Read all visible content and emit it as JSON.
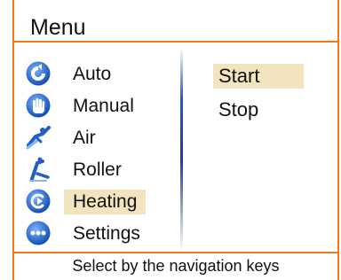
{
  "header": {
    "title": "Menu"
  },
  "menu": {
    "items": [
      {
        "label": "Auto",
        "icon": "auto-icon",
        "selected": false
      },
      {
        "label": "Manual",
        "icon": "hand-icon",
        "selected": false
      },
      {
        "label": "Air",
        "icon": "air-massage-icon",
        "selected": false
      },
      {
        "label": "Roller",
        "icon": "roller-icon",
        "selected": false
      },
      {
        "label": "Heating",
        "icon": "heating-icon",
        "selected": true
      },
      {
        "label": "Settings",
        "icon": "settings-icon",
        "selected": false
      }
    ]
  },
  "options": {
    "items": [
      {
        "label": "Start",
        "selected": true
      },
      {
        "label": "Stop",
        "selected": false
      }
    ]
  },
  "footer": {
    "hint": "Select by the navigation keys"
  },
  "colors": {
    "accent": "#f07b1f",
    "highlight": "#f3e4c0",
    "icon_blue": "#1f5fc7"
  }
}
